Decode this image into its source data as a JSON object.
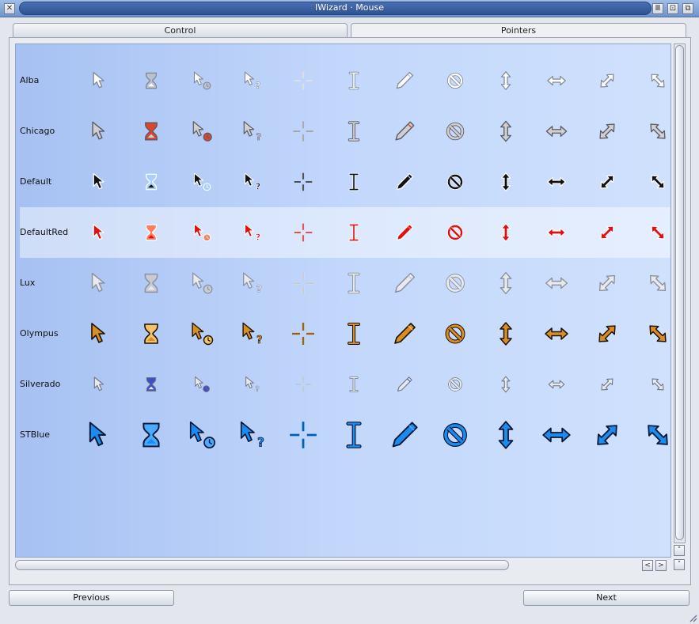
{
  "window": {
    "title": "IWizard · Mouse",
    "close_glyph": "✕",
    "iconify_glyph": "Ⅲ",
    "zoom_glyph": "⊡",
    "depth_glyph": "⧉"
  },
  "tabs": [
    {
      "label": "Control",
      "selected": false
    },
    {
      "label": "Pointers",
      "selected": true
    }
  ],
  "pointer_columns": [
    "normal",
    "busy",
    "working",
    "help",
    "precision",
    "text",
    "pen",
    "unavailable",
    "vertical-resize",
    "horizontal-resize",
    "diagonal-resize-1",
    "diagonal-resize-2"
  ],
  "themes": [
    {
      "name": "Alba",
      "style": {
        "fill": "#ffffff",
        "stroke": "#7f8796",
        "accent": "#b9c1cf",
        "scale": 0.8
      }
    },
    {
      "name": "Chicago",
      "style": {
        "fill": "#cfcfd4",
        "stroke": "#5c5c63",
        "accent": "#d8462f",
        "scale": 0.9
      }
    },
    {
      "name": "Default",
      "style": {
        "fill": "#111111",
        "stroke": "#ffffff",
        "accent": "#a6d0ff",
        "scale": 0.8
      }
    },
    {
      "name": "DefaultRed",
      "style": {
        "fill": "#e10f0f",
        "stroke": "#ffffff",
        "accent": "#ff7b5a",
        "scale": 0.8
      },
      "selected": true
    },
    {
      "name": "Lux",
      "style": {
        "fill": "#e8eaee",
        "stroke": "#8c93a0",
        "accent": "#c7cbd3",
        "scale": 0.95
      }
    },
    {
      "name": "Olympus",
      "style": {
        "fill": "#d98e22",
        "stroke": "#1c1208",
        "accent": "#f2c36a",
        "scale": 1.0
      }
    },
    {
      "name": "Silverado",
      "style": {
        "fill": "#e6e9ef",
        "stroke": "#6d7483",
        "accent": "#3f4ec7",
        "scale": 0.7
      }
    },
    {
      "name": "STBlue",
      "style": {
        "fill": "#1a8cf0",
        "stroke": "#061634",
        "accent": "#49aaff",
        "scale": 1.2
      }
    }
  ],
  "scrollbar": {
    "up_glyph": "˄",
    "down_glyph": "˅",
    "left_glyph": "<",
    "right_glyph": ">"
  },
  "buttons": {
    "previous": "Previous",
    "next": "Next"
  }
}
